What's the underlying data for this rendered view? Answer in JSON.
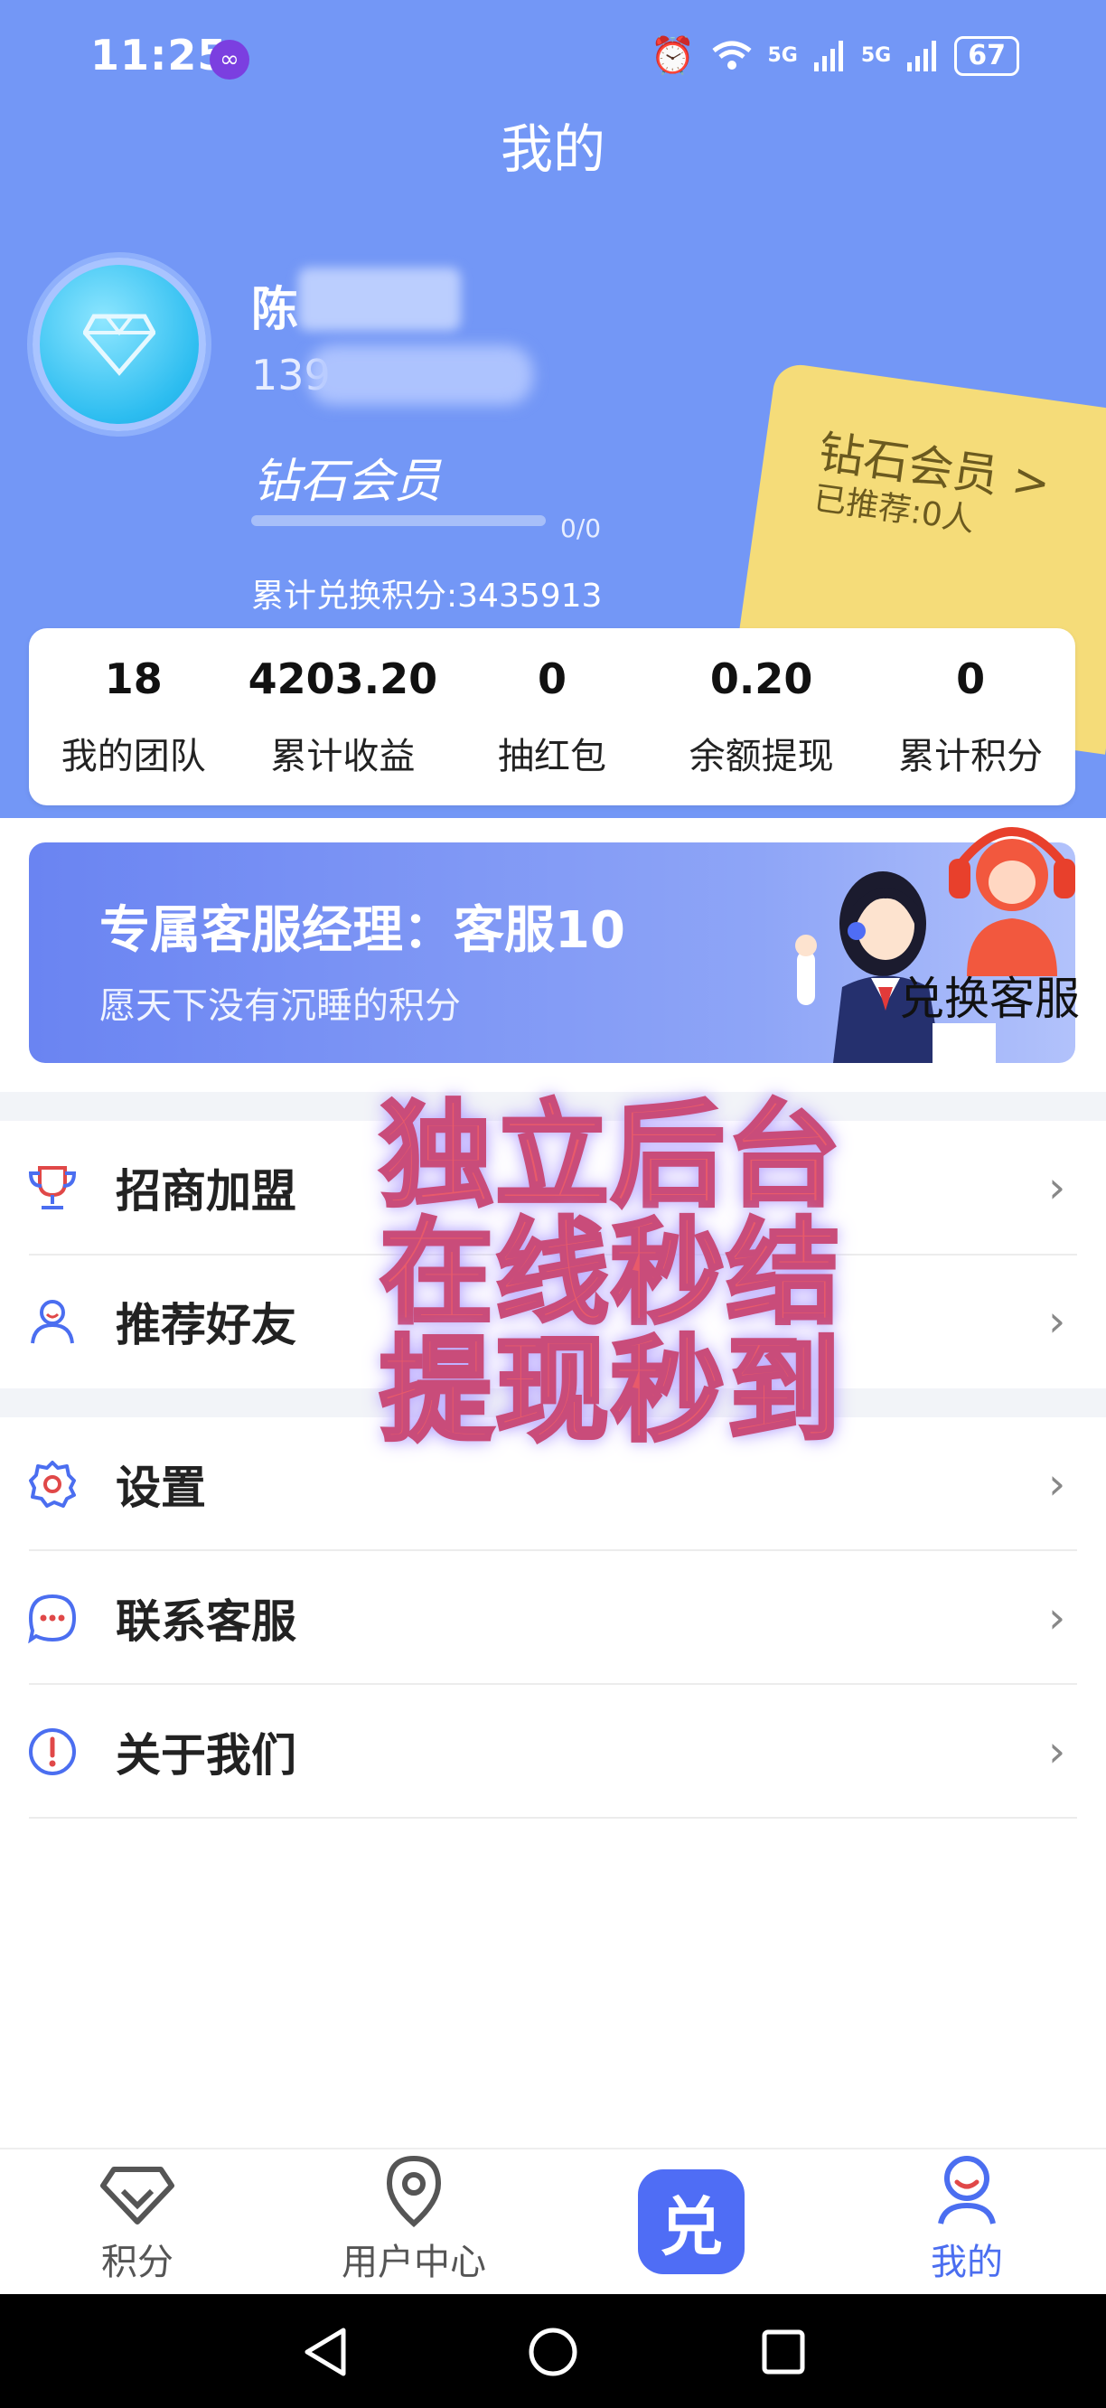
{
  "statusbar": {
    "time": "11:25",
    "app_badge": "∞",
    "net1": "5G",
    "net2": "5G",
    "battery": "67"
  },
  "header": {
    "title": "我的"
  },
  "user": {
    "name": "陈",
    "phone": "139",
    "level": "钻石会员",
    "progress": "0/0",
    "progress_value": 0,
    "total_exchange": "累计兑换积分:3435913"
  },
  "vip_card": {
    "title": "钻石会员 >",
    "subtitle": "已推荐:0人"
  },
  "stats": [
    {
      "value": "18",
      "label": "我的团队"
    },
    {
      "value": "4203.20",
      "label": "累计收益"
    },
    {
      "value": "0",
      "label": "抽红包"
    },
    {
      "value": "0.20",
      "label": "余额提现"
    },
    {
      "value": "0",
      "label": "累计积分"
    }
  ],
  "service_banner": {
    "title": "专属客服经理：客服10",
    "subtitle": "愿天下没有沉睡的积分"
  },
  "exchange_service": {
    "label": "兑换客服"
  },
  "menu_group1": [
    {
      "label": "招商加盟",
      "icon": "trophy-icon"
    },
    {
      "label": "推荐好友",
      "icon": "user-icon"
    }
  ],
  "menu_group2": [
    {
      "label": "设置",
      "icon": "gear-icon"
    },
    {
      "label": "联系客服",
      "icon": "chat-icon"
    },
    {
      "label": "关于我们",
      "icon": "info-icon"
    }
  ],
  "promo": {
    "line1": "独立后台",
    "line2": "在线秒结",
    "line3": "提现秒到"
  },
  "tabs": {
    "points": "积分",
    "user_center": "用户中心",
    "exchange": "兑",
    "mine": "我的"
  },
  "colors": {
    "header_blue": "#7397f6",
    "accent_blue": "#4b6ef0",
    "vip_gold": "#f5dc79"
  }
}
